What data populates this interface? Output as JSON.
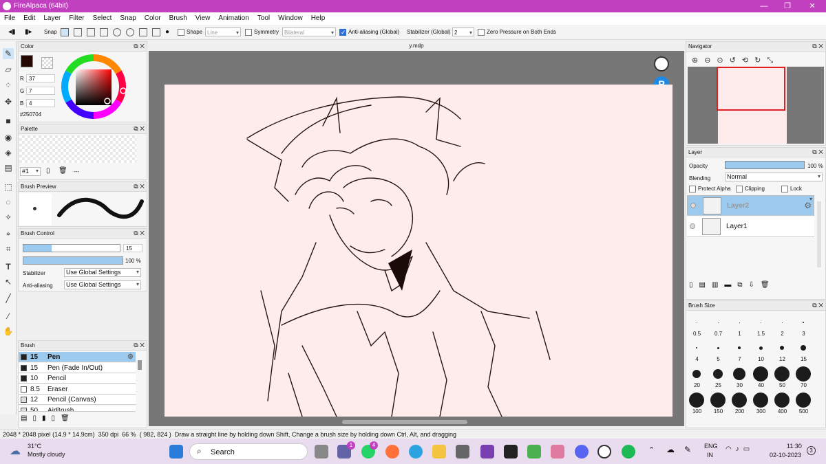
{
  "window": {
    "title": "FireAlpaca (64bit)",
    "minimize": "—",
    "maximize": "❐",
    "close": "✕"
  },
  "menu": [
    "File",
    "Edit",
    "Layer",
    "Filter",
    "Select",
    "Snap",
    "Color",
    "Brush",
    "View",
    "Animation",
    "Tool",
    "Window",
    "Help"
  ],
  "toolbar": {
    "snap_label": "Snap",
    "shape_label": "Shape",
    "shape_value": "Line",
    "symmetry_label": "Symmetry",
    "symmetry_value": "Bilateral",
    "antialias_label": "Anti-aliasing (Global)",
    "stabilizer_label": "Stabilizer (Global)",
    "stabilizer_value": "2",
    "zero_pressure_label": "Zero Pressure on Both Ends"
  },
  "color_panel": {
    "title": "Color",
    "r_label": "R",
    "r": "37",
    "g_label": "G",
    "g": "7",
    "b_label": "B",
    "b": "4",
    "hex": "#250704",
    "swatch": "#250704"
  },
  "palette_panel": {
    "title": "Palette",
    "selector": "#1",
    "dashes": "---"
  },
  "brush_preview_panel": {
    "title": "Brush Preview"
  },
  "brush_control_panel": {
    "title": "Brush Control",
    "size_value": "15",
    "opacity_value": "100 %",
    "stabilizer_label": "Stabilizer",
    "stabilizer_value": "Use Global Settings",
    "antialias_label": "Anti-aliasing",
    "antialias_value": "Use Global Settings"
  },
  "brush_panel": {
    "title": "Brush",
    "items": [
      {
        "size": "15",
        "name": "Pen",
        "swatch": "#222222"
      },
      {
        "size": "15",
        "name": "Pen (Fade In/Out)",
        "swatch": "#222222"
      },
      {
        "size": "10",
        "name": "Pencil",
        "swatch": "#222222"
      },
      {
        "size": "8.5",
        "name": "Eraser",
        "swatch": "#ffffff"
      },
      {
        "size": "12",
        "name": "Pencil (Canvas)",
        "swatch": "#dddddd"
      },
      {
        "size": "50",
        "name": "AirBrush",
        "swatch": "#dddddd"
      }
    ]
  },
  "document": {
    "tab_title": "y.mdp"
  },
  "navigator_panel": {
    "title": "Navigator"
  },
  "layer_panel": {
    "title": "Layer",
    "opacity_label": "Opacity",
    "opacity_value": "100 %",
    "blending_label": "Blending",
    "blending_value": "Normal",
    "protect_alpha": "Protect Alpha",
    "clipping": "Clipping",
    "lock": "Lock",
    "layers": [
      {
        "name": "Layer2"
      },
      {
        "name": "Layer1"
      }
    ]
  },
  "brush_size_panel": {
    "title": "Brush Size",
    "row1": [
      "0.5",
      "0.7",
      "1",
      "1.5",
      "2",
      "3"
    ],
    "row2": [
      "4",
      "5",
      "7",
      "10",
      "12",
      "15"
    ],
    "row3": [
      "20",
      "25",
      "30",
      "40",
      "50",
      "70"
    ],
    "row4": [
      "100",
      "150",
      "200",
      "300",
      "400",
      "500"
    ]
  },
  "status": {
    "dimensions": "2048 * 2048 pixel",
    "physical": "(14.9 * 14.9cm)",
    "dpi": "350 dpi",
    "zoom": "66 %",
    "cursor": "( 982, 824 )",
    "hint": "Draw a straight line by holding down Shift, Change a brush size by holding down Ctrl, Alt, and dragging"
  },
  "taskbar": {
    "temp": "31°C",
    "weather": "Mostly cloudy",
    "search": "Search",
    "lang1": "ENG",
    "lang2": "IN",
    "time": "11:30",
    "date": "02-10-2023",
    "badge_teams": "1",
    "badge_whatsapp": "4",
    "notif": "3"
  }
}
